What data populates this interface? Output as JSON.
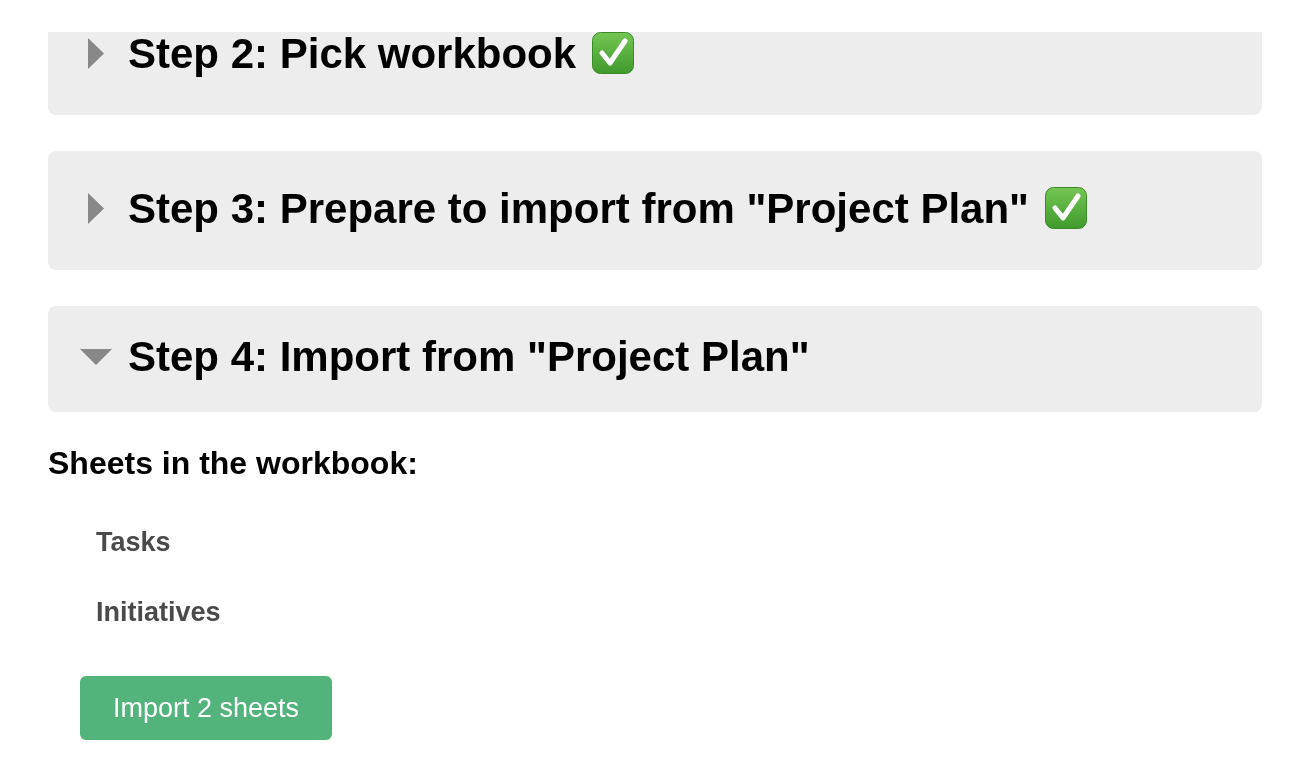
{
  "steps": [
    {
      "title": "Step 2: Pick workbook",
      "expanded": false,
      "done": true
    },
    {
      "title": "Step 3: Prepare to import from \"Project Plan\"",
      "expanded": false,
      "done": true
    },
    {
      "title": "Step 4: Import from \"Project Plan\"",
      "expanded": true,
      "done": false,
      "body": {
        "heading": "Sheets in the workbook:",
        "sheets": [
          "Tasks",
          "Initiatives"
        ],
        "import_button": "Import 2 sheets"
      }
    }
  ]
}
